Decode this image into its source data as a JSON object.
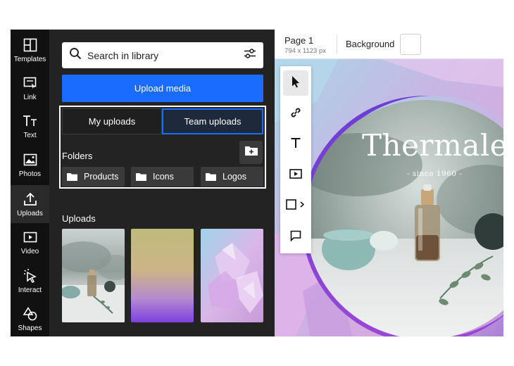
{
  "rail": {
    "items": [
      {
        "label": "Templates",
        "icon": "templates-icon"
      },
      {
        "label": "Link",
        "icon": "link-icon"
      },
      {
        "label": "Text",
        "icon": "text-icon"
      },
      {
        "label": "Photos",
        "icon": "photos-icon"
      },
      {
        "label": "Uploads",
        "icon": "uploads-icon",
        "active": true
      },
      {
        "label": "Video",
        "icon": "video-icon"
      },
      {
        "label": "Interact",
        "icon": "interact-icon"
      },
      {
        "label": "Shapes",
        "icon": "shapes-icon"
      }
    ]
  },
  "library": {
    "search_placeholder": "Search in library",
    "upload_label": "Upload media",
    "tabs": [
      {
        "label": "My uploads",
        "active": false
      },
      {
        "label": "Team uploads",
        "active": true
      }
    ],
    "folders_title": "Folders",
    "folders": [
      "Products",
      "Icons",
      "Logos"
    ],
    "uploads_title": "Uploads",
    "uploads": [
      "bottle-photo",
      "purple-gradient",
      "crystal-photo"
    ]
  },
  "editor": {
    "page_name": "Page 1",
    "page_size": "794 x 1123 px",
    "background_label": "Background",
    "background_color": "#ffffff",
    "brand": "Thermale",
    "since": "- since 1960 -",
    "tools": [
      "select-icon",
      "link-icon",
      "text-icon",
      "video-icon",
      "shape-icon",
      "comment-icon"
    ]
  },
  "colors": {
    "accent": "#1a6cff",
    "rail_bg": "#111111",
    "panel_bg": "#232323",
    "folder_bg": "#3a3a3a"
  }
}
